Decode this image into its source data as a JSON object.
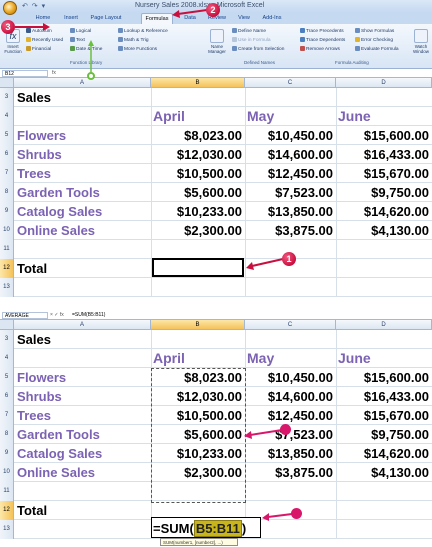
{
  "colors": {
    "label_purple": "#7b62b3",
    "callout_red": "#c8103f",
    "callout_magenta": "#d8176b",
    "ribbon_blue": "#c5d9f1"
  },
  "top": {
    "title_bar": {
      "qat": "↶ ↷ ▾",
      "title": "Nursery Sales 2008.xlsx - Microsoft Excel"
    },
    "tabs": [
      "Home",
      "Insert",
      "Page Layout",
      "Formulas",
      "Data",
      "Review",
      "View",
      "Add-Ins"
    ],
    "ribbon": {
      "insert_function": "Insert Function",
      "library_cmds": [
        "AutoSum",
        "Recently Used",
        "Financial",
        "Logical",
        "Text",
        "Date & Time",
        "Lookup & Reference",
        "Math & Trig",
        "More Functions"
      ],
      "library_label": "Function Library",
      "name_manager": "Name Manager",
      "names_cmds": [
        "Define Name",
        "Use in Formula",
        "Create from Selection"
      ],
      "names_label": "Defined Names",
      "audit_cmds": [
        "Trace Precedents",
        "Trace Dependents",
        "Remove Arrows",
        "Show Formulas",
        "Error Checking",
        "Evaluate Formula"
      ],
      "audit_label": "Formula Auditing",
      "watch": "Watch Window"
    },
    "name_box": "B12",
    "formula": "",
    "columns": [
      "A",
      "B",
      "C",
      "D"
    ],
    "callouts": [
      "3",
      "2",
      "1"
    ]
  },
  "bottom": {
    "name_box": "AVERAGE",
    "formula_btns": "× ✓ fx",
    "formula": "=SUM(B5:B11)",
    "columns": [
      "A",
      "B",
      "C",
      "D"
    ],
    "editing_formula": {
      "prefix": "=SUM(",
      "range": "B5:B11",
      "suffix": ")"
    },
    "tooltip": "SUM(number1, [number2], ...)"
  },
  "sheet": {
    "rows": [
      {
        "num": "3",
        "a": "Sales",
        "b": "",
        "c": "",
        "d": ""
      },
      {
        "num": "4",
        "a": "",
        "b": "April",
        "c": "May",
        "d": "June"
      },
      {
        "num": "5",
        "a": "Flowers",
        "b": "$8,023.00",
        "c": "$10,450.00",
        "d": "$15,600.00"
      },
      {
        "num": "6",
        "a": "Shrubs",
        "b": "$12,030.00",
        "c": "$14,600.00",
        "d": "$16,433.00"
      },
      {
        "num": "7",
        "a": "Trees",
        "b": "$10,500.00",
        "c": "$12,450.00",
        "d": "$15,670.00"
      },
      {
        "num": "8",
        "a": "Garden Tools",
        "b": "$5,600.00",
        "c": "$7,523.00",
        "d": "$9,750.00"
      },
      {
        "num": "9",
        "a": "Catalog Sales",
        "b": "$10,233.00",
        "c": "$13,850.00",
        "d": "$14,620.00"
      },
      {
        "num": "10",
        "a": "Online Sales",
        "b": "$2,300.00",
        "c": "$3,875.00",
        "d": "$4,130.00"
      },
      {
        "num": "11",
        "a": "",
        "b": "",
        "c": "",
        "d": ""
      },
      {
        "num": "12",
        "a": "Total",
        "b": "",
        "c": "",
        "d": ""
      },
      {
        "num": "13",
        "a": "",
        "b": "",
        "c": "",
        "d": ""
      }
    ]
  }
}
